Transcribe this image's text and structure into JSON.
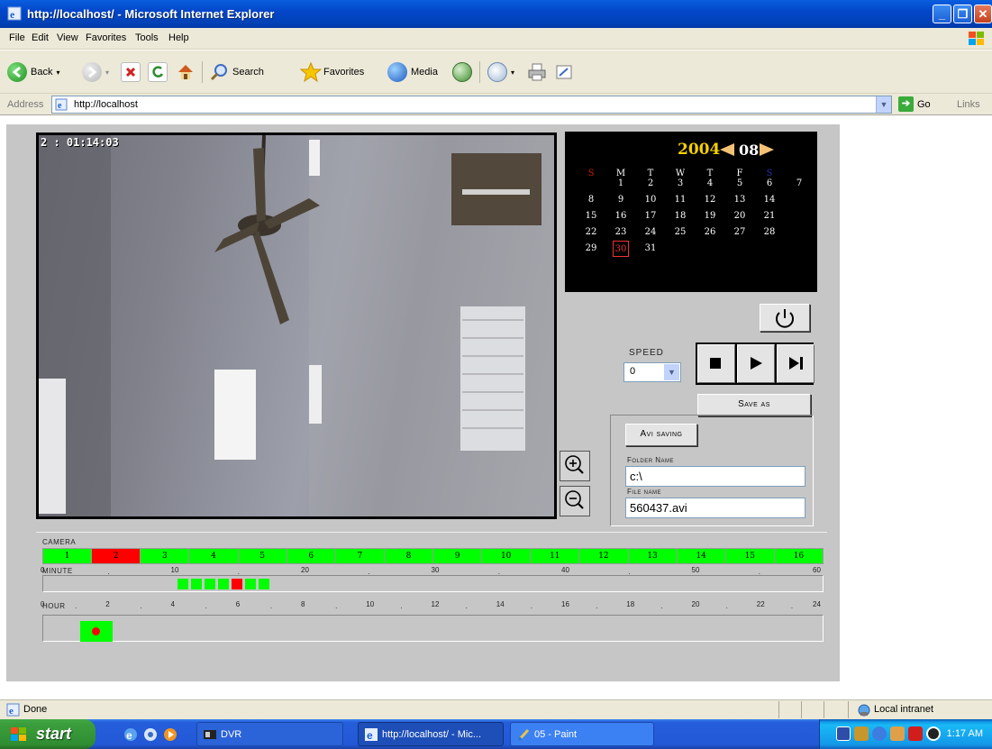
{
  "window": {
    "title": "http://localhost/ - Microsoft Internet Explorer"
  },
  "menu": [
    "File",
    "Edit",
    "View",
    "Favorites",
    "Tools",
    "Help"
  ],
  "toolbar": {
    "back": "Back",
    "search": "Search",
    "favorites": "Favorites",
    "media": "Media"
  },
  "address": {
    "label": "Address",
    "url": "http://localhost",
    "go": "Go",
    "links": "Links"
  },
  "video": {
    "timestamp": "2 : 01:14:03"
  },
  "calendar": {
    "year": "2004",
    "month": "08",
    "weekdays": [
      "S",
      "M",
      "T",
      "W",
      "T",
      "F",
      "S"
    ],
    "weeks": [
      [
        "",
        "1",
        "2",
        "3",
        "4",
        "5",
        "6",
        "7"
      ],
      [
        "8",
        "9",
        "10",
        "11",
        "12",
        "13",
        "14"
      ],
      [
        "15",
        "16",
        "17",
        "18",
        "19",
        "20",
        "21"
      ],
      [
        "22",
        "23",
        "24",
        "25",
        "26",
        "27",
        "28"
      ],
      [
        "29",
        "30",
        "31"
      ]
    ],
    "selected": "30",
    "weekday_colors": {
      "sunday": "#cc2200",
      "saturday": "#2233aa"
    }
  },
  "controls": {
    "speed_label": "SPEED",
    "speed_value": "0",
    "save_as": "Save as",
    "avi_saving": "Avi saving",
    "folder_label": "Folder Name",
    "folder_value": "c:\\",
    "file_label": "File name",
    "file_value": "560437.avi"
  },
  "timeline": {
    "camera_label": "CAMERA",
    "cameras": [
      "1",
      "2",
      "3",
      "4",
      "5",
      "6",
      "7",
      "8",
      "9",
      "10",
      "11",
      "12",
      "13",
      "14",
      "15",
      "16"
    ],
    "camera_active": "2",
    "minute_label": "MINUTE",
    "minute_ticks": [
      "0",
      "10",
      "20",
      "30",
      "40",
      "50",
      "60"
    ],
    "hour_label": "HOUR",
    "hour_ticks": [
      "0",
      "2",
      "4",
      "6",
      "8",
      "10",
      "12",
      "14",
      "16",
      "18",
      "20",
      "22",
      "24"
    ],
    "minute_segments": [
      "green",
      "green",
      "green",
      "green",
      "red",
      "green",
      "green"
    ]
  },
  "status": {
    "text": "Done",
    "zone": "Local intranet"
  },
  "taskbar": {
    "start": "start",
    "tasks": [
      "DVR",
      "http://localhost/ - Mic...",
      "05 - Paint"
    ],
    "clock": "1:17 AM"
  }
}
